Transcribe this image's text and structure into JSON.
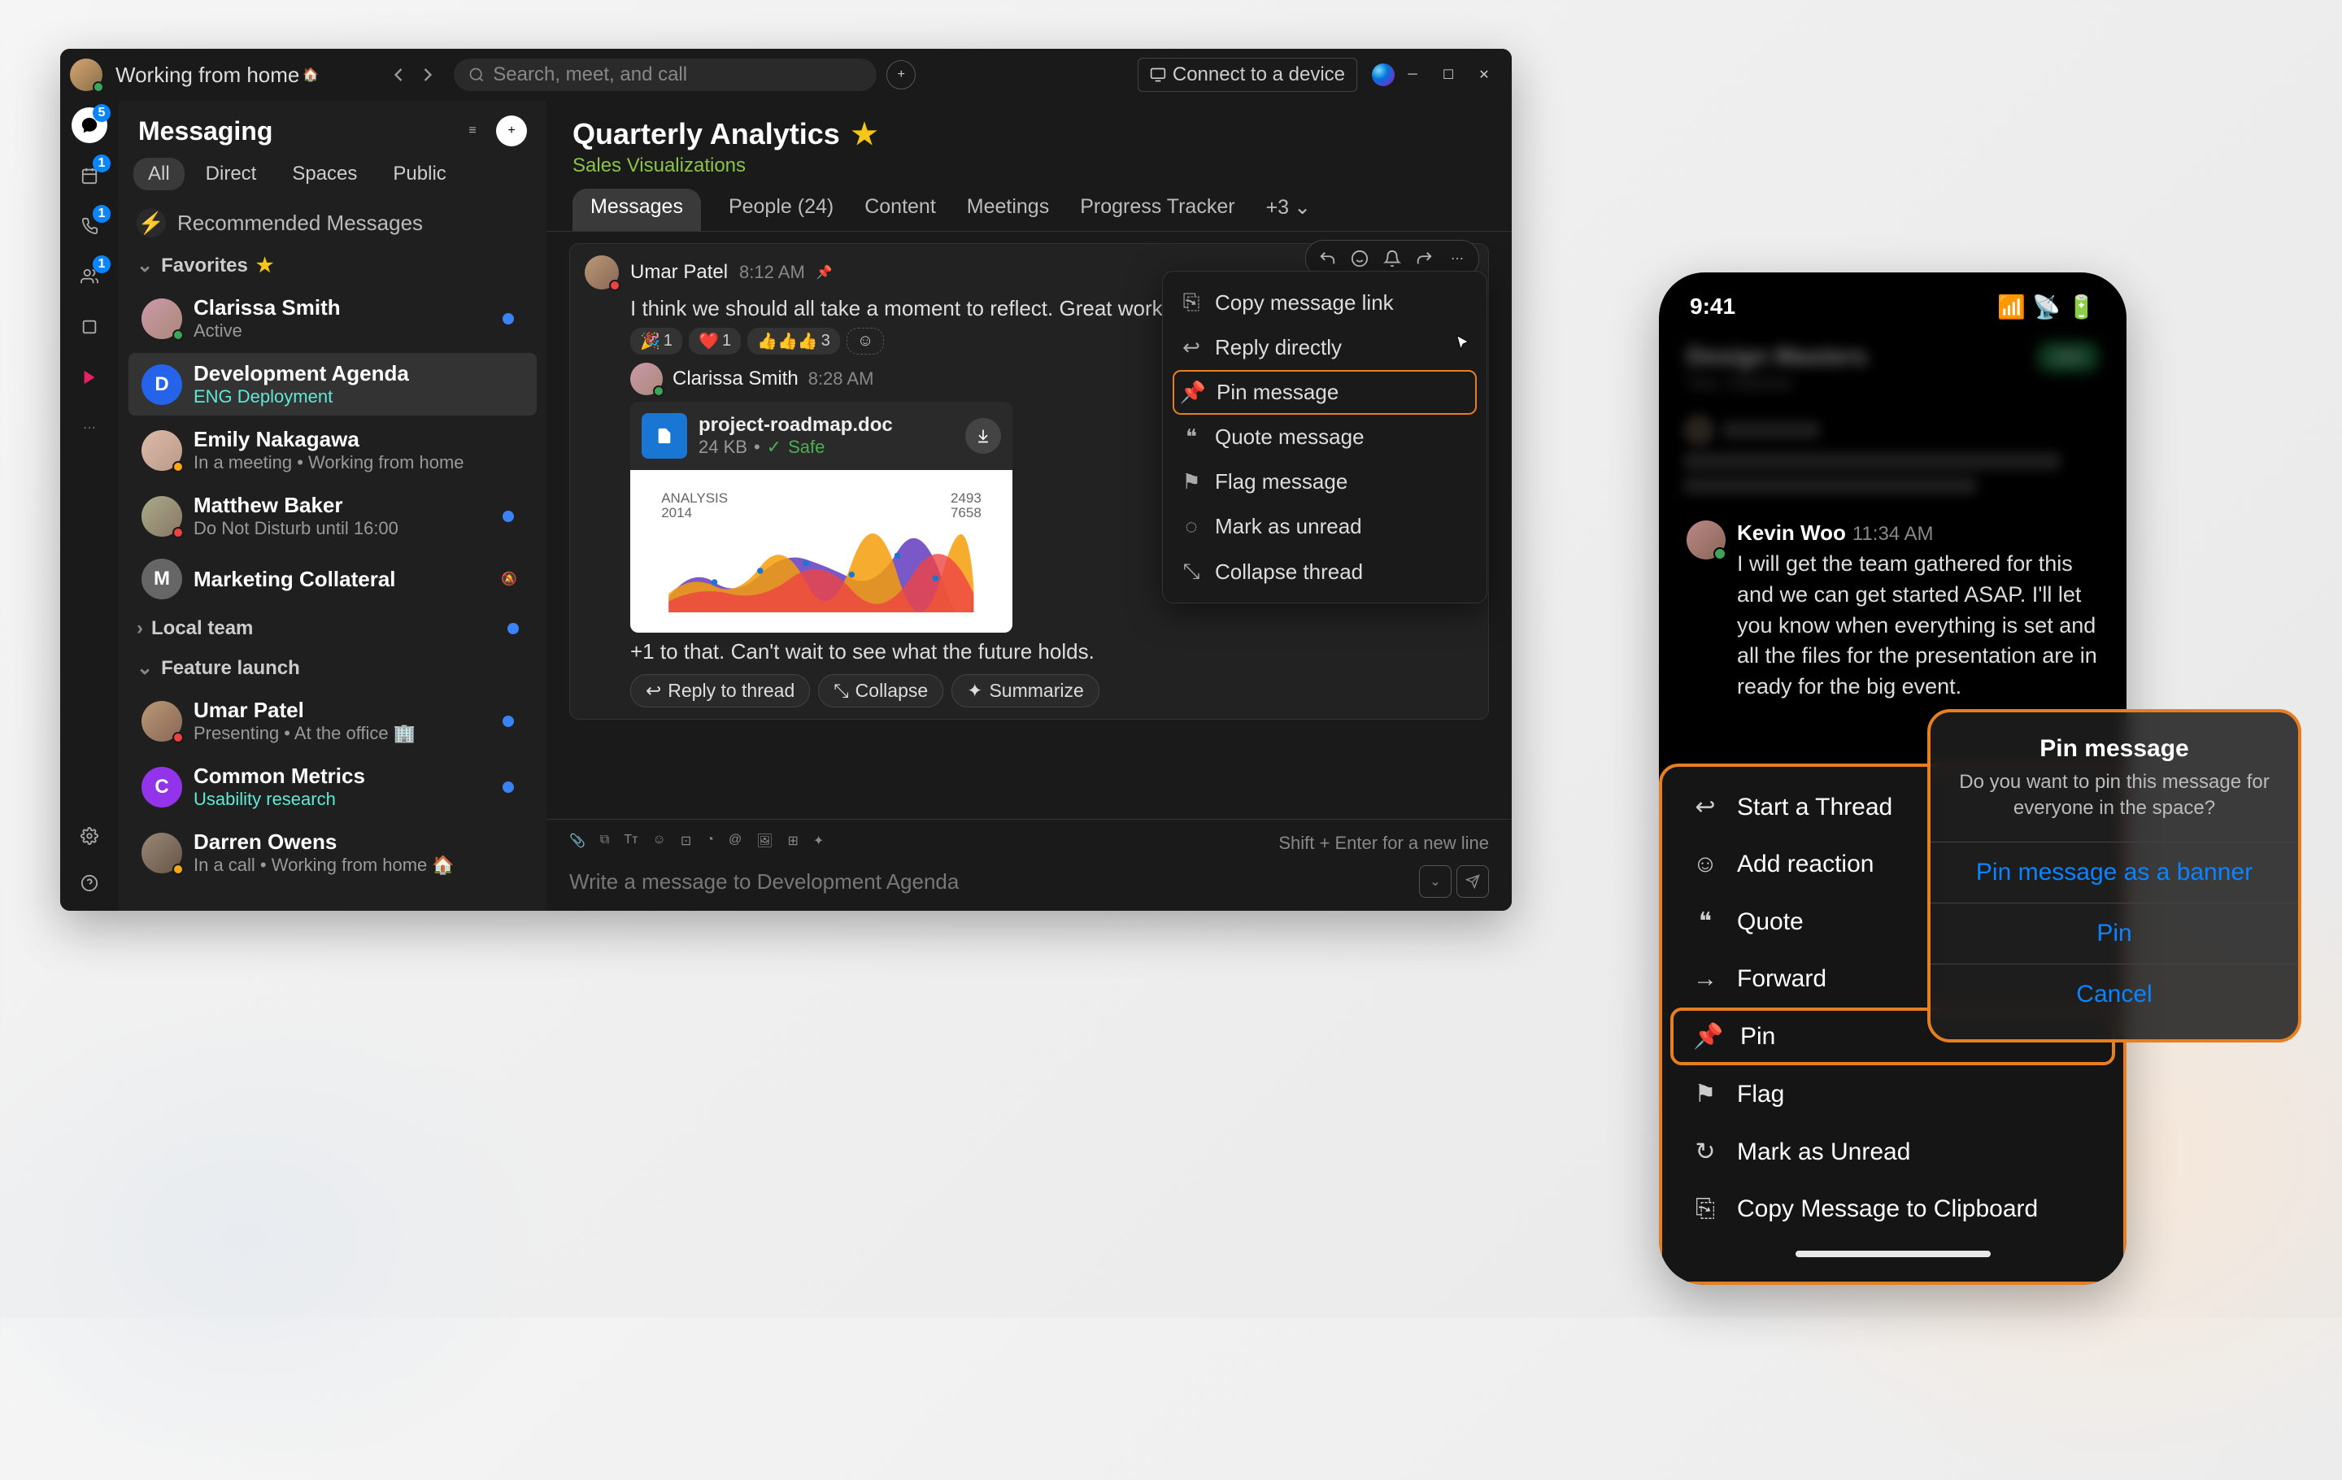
{
  "titlebar": {
    "status": "Working from home",
    "search_ph": "Search, meet, and call",
    "connect": "Connect to a device"
  },
  "rail": {
    "msg_badge": "5",
    "cal_badge": "1",
    "call_badge": "1",
    "team_badge": "1"
  },
  "sidebar": {
    "title": "Messaging",
    "filters": [
      "All",
      "Direct",
      "Spaces",
      "Public"
    ],
    "recommended": "Recommended Messages",
    "favorites": "Favorites",
    "local": "Local team",
    "feature": "Feature launch",
    "contacts": {
      "clarissa": {
        "name": "Clarissa Smith",
        "sub": "Active"
      },
      "dev": {
        "name": "Development Agenda",
        "sub": "ENG Deployment"
      },
      "emily": {
        "name": "Emily Nakagawa",
        "sub": "In a meeting  •  Working from home"
      },
      "matthew": {
        "name": "Matthew Baker",
        "sub": "Do Not Disturb until 16:00"
      },
      "marketing": {
        "name": "Marketing Collateral"
      },
      "umar": {
        "name": "Umar Patel",
        "sub": "Presenting  •  At the office 🏢"
      },
      "common": {
        "name": "Common Metrics",
        "sub": "Usability research"
      },
      "darren": {
        "name": "Darren Owens",
        "sub": "In a call  •  Working from home 🏠"
      }
    }
  },
  "main": {
    "title": "Quarterly Analytics",
    "subtitle": "Sales Visualizations",
    "tabs": {
      "messages": "Messages",
      "people": "People (24)",
      "content": "Content",
      "meetings": "Meetings",
      "progress": "Progress Tracker",
      "more": "+3"
    },
    "msg1": {
      "author": "Umar Patel",
      "time": "8:12 AM",
      "text": "I think we should all take a moment to reflect. Great work e",
      "r1": "1",
      "r2": "1",
      "r3": "3"
    },
    "msg2": {
      "author": "Clarissa Smith",
      "time": "8:28 AM",
      "file": "project-roadmap.doc",
      "size": "24 KB",
      "safe": "Safe",
      "text": "+1 to that. Can't wait to see what the future holds."
    },
    "chart_data": {
      "type": "area",
      "title": "ANALYSIS",
      "subtitle": "2014",
      "labels": [
        "2493",
        "7658"
      ]
    },
    "actions": {
      "reply": "Reply to thread",
      "collapse": "Collapse",
      "summarize": "Summarize"
    },
    "ctx": {
      "copy": "Copy message link",
      "reply": "Reply directly",
      "pin": "Pin message",
      "quote": "Quote message",
      "flag": "Flag message",
      "unread": "Mark as unread",
      "collapse": "Collapse thread"
    }
  },
  "composer": {
    "ph": "Write a message to Development Agenda",
    "hint": "Shift + Enter for a new line"
  },
  "mobile": {
    "time": "9:41",
    "msg": {
      "author": "Kevin Woo",
      "time": "11:34 AM",
      "text": "I will get the team gathered for this and we can get started ASAP. I'll let you know when everything is set and all the files for the presentation are in ready for the big event."
    },
    "actions": {
      "thread": "Start a Thread",
      "react": "Add reaction",
      "quote": "Quote",
      "forward": "Forward",
      "pin": "Pin",
      "flag": "Flag",
      "unread": "Mark as Unread",
      "copy": "Copy Message to Clipboard"
    },
    "panel": {
      "title": "Pin message",
      "sub": "Do you want to pin this message for everyone in the space?",
      "banner": "Pin message as a banner",
      "pin": "Pin",
      "cancel": "Cancel"
    }
  }
}
